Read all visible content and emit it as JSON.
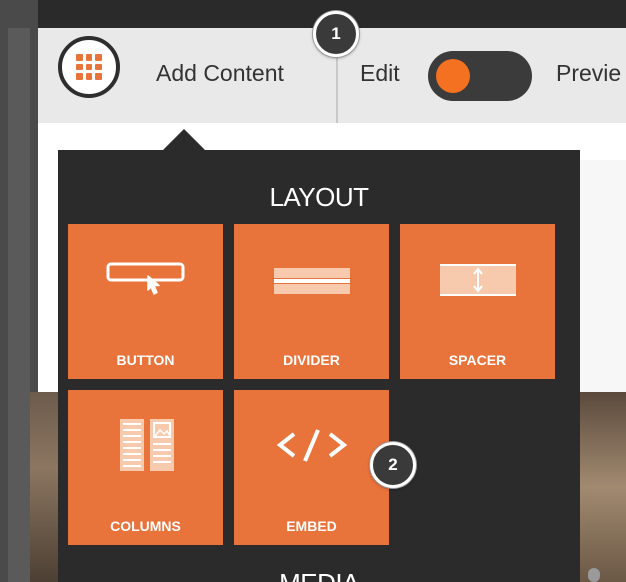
{
  "toolbar": {
    "add_content_label": "Add Content",
    "edit_label": "Edit",
    "preview_label": "Previe",
    "toggle_on": true
  },
  "callouts": [
    "1",
    "2"
  ],
  "popover": {
    "sections": [
      {
        "title": "LAYOUT",
        "items": [
          {
            "label": "BUTTON",
            "icon": "button-click-icon"
          },
          {
            "label": "DIVIDER",
            "icon": "divider-icon"
          },
          {
            "label": "SPACER",
            "icon": "spacer-icon"
          },
          {
            "label": "COLUMNS",
            "icon": "columns-icon"
          },
          {
            "label": "EMBED",
            "icon": "embed-code-icon"
          }
        ]
      },
      {
        "title": "MEDIA"
      }
    ]
  },
  "colors": {
    "accent": "#e8733b",
    "toggle_knob": "#f37120",
    "popover_bg": "#2b2b2b",
    "toolbar_bg": "#e9e9e9"
  }
}
